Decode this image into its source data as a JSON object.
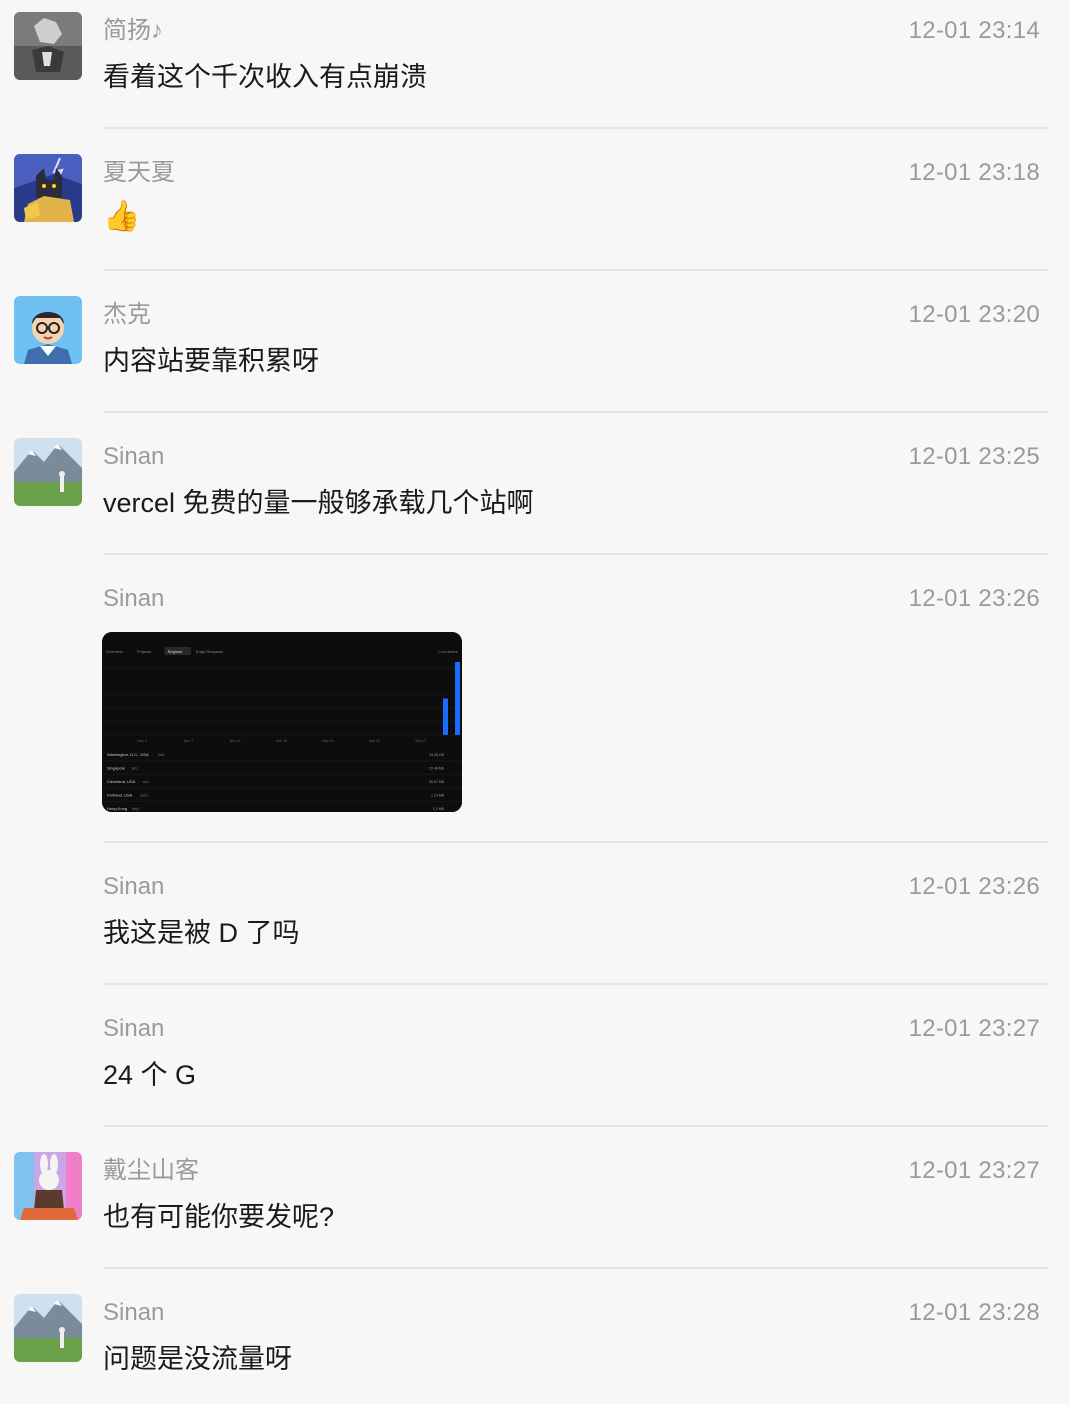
{
  "messages": [
    {
      "name": "简扬♪",
      "time": "12-01 23:14",
      "text": "看着这个千次收入有点崩溃"
    },
    {
      "name": "夏天夏",
      "time": "12-01 23:18",
      "text": "👍"
    },
    {
      "name": "杰克",
      "time": "12-01 23:20",
      "text": "内容站要靠积累呀"
    },
    {
      "name": "Sinan",
      "time": "12-01 23:25",
      "text": "vercel 免费的量一般够承载几个站啊"
    },
    {
      "name": "Sinan",
      "time": "12-01 23:26",
      "text": ""
    },
    {
      "name": "Sinan",
      "time": "12-01 23:26",
      "text": "我这是被 D 了吗"
    },
    {
      "name": "Sinan",
      "time": "12-01 23:27",
      "text": "24 个 G"
    },
    {
      "name": "戴尘山客",
      "time": "12-01 23:27",
      "text": "也有可能你要发呢?"
    },
    {
      "name": "Sinan",
      "time": "12-01 23:28",
      "text": "问题是没流量呀"
    }
  ],
  "screenshot": {
    "tabs": [
      "Overview",
      "Projects",
      "Regions",
      "Edge Requests"
    ],
    "right_label": "Cumulative",
    "x_ticks": [
      "Nov 3",
      "Nov 7",
      "Nov 11",
      "Nov 15",
      "Nov 19",
      "Nov 23",
      "Nov 27"
    ],
    "chart_data": {
      "type": "bar",
      "values": [
        0.15,
        0.3
      ]
    },
    "regions": [
      {
        "name": "Washington, D.C., USA",
        "code": "iad1",
        "value": "24.28 GB"
      },
      {
        "name": "Singapore",
        "code": "sin1",
        "value": "22.48 MB"
      },
      {
        "name": "Cleveland, USA",
        "code": "cle1",
        "value": "56.67 MB"
      },
      {
        "name": "Portland, USA",
        "code": "pdx1",
        "value": "1.23 MB"
      },
      {
        "name": "Hong Kong",
        "code": "hkg1",
        "value": "1.2 MB"
      }
    ]
  }
}
